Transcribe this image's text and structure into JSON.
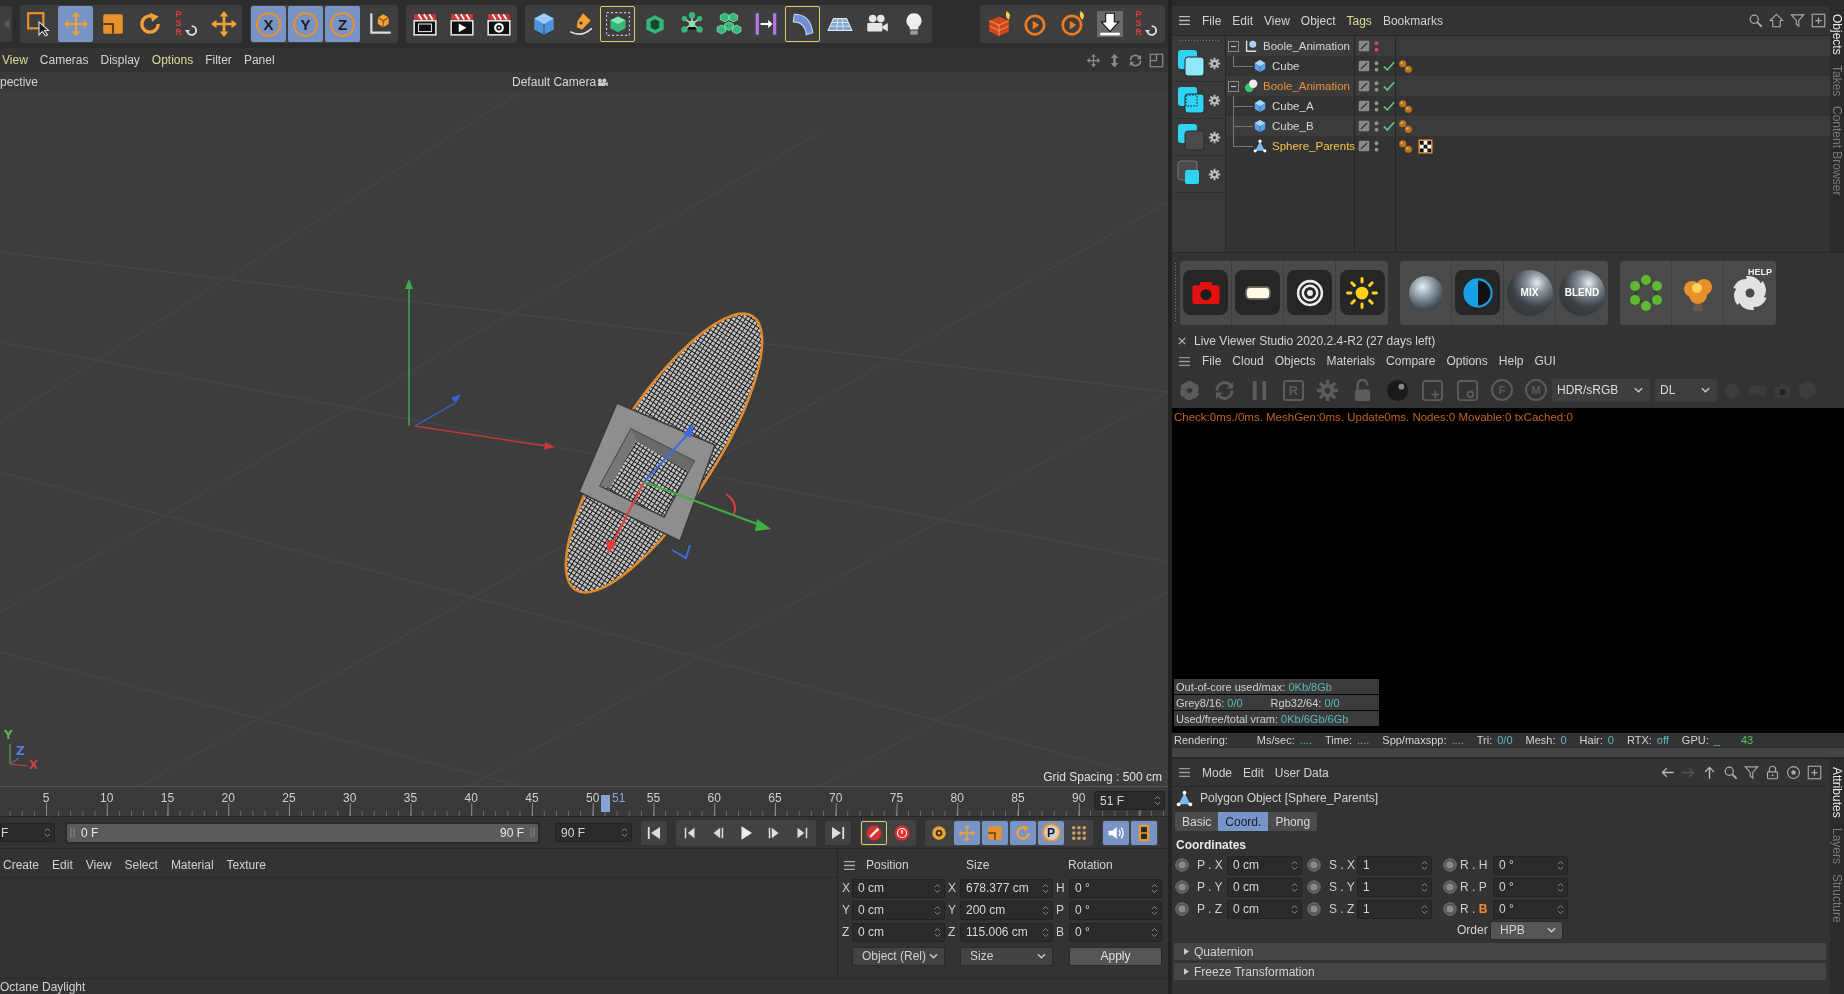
{
  "toolbar": {
    "groups": [
      [
        {
          "kind": "back",
          "selected": false,
          "framed": false
        }
      ],
      [
        {
          "kind": "select",
          "selected": false,
          "framed": false
        },
        {
          "kind": "move",
          "selected": true,
          "framed": false
        },
        {
          "kind": "scale",
          "selected": false,
          "framed": false
        },
        {
          "kind": "rotate",
          "selected": false,
          "framed": false
        },
        {
          "kind": "psr",
          "label": "PSR",
          "selected": false,
          "framed": false
        },
        {
          "kind": "move-plus",
          "selected": false,
          "framed": false
        }
      ],
      [
        {
          "kind": "axis",
          "label": "X",
          "selected": true,
          "framed": false
        },
        {
          "kind": "axis",
          "label": "Y",
          "selected": true,
          "framed": false
        },
        {
          "kind": "axis",
          "label": "Z",
          "selected": true,
          "framed": false
        },
        {
          "kind": "coord-system",
          "selected": false,
          "framed": false
        }
      ],
      [
        {
          "kind": "render-view",
          "selected": false,
          "framed": false
        },
        {
          "kind": "render-picture",
          "selected": false,
          "framed": false
        },
        {
          "kind": "render-settings",
          "selected": false,
          "framed": false
        }
      ],
      [
        {
          "kind": "cube",
          "selected": false,
          "framed": false
        },
        {
          "kind": "pen",
          "selected": false,
          "framed": false
        },
        {
          "kind": "subdivision",
          "selected": false,
          "framed": true
        },
        {
          "kind": "extrude",
          "selected": false,
          "framed": false
        },
        {
          "kind": "cloner",
          "selected": false,
          "framed": false
        },
        {
          "kind": "array",
          "selected": false,
          "framed": false
        },
        {
          "kind": "spline-bar",
          "selected": false,
          "framed": false
        },
        {
          "kind": "deformer",
          "selected": false,
          "framed": true
        },
        {
          "kind": "floor",
          "selected": false,
          "framed": false
        },
        {
          "kind": "camera",
          "selected": false,
          "framed": false
        },
        {
          "kind": "light",
          "selected": false,
          "framed": false
        }
      ],
      [
        {
          "kind": "octane-cube",
          "selected": false,
          "framed": false
        },
        {
          "kind": "octane-render",
          "selected": false,
          "framed": false
        },
        {
          "kind": "octane-render-fire",
          "selected": false,
          "framed": false
        },
        {
          "kind": "octane-download",
          "selected": false,
          "framed": false
        },
        {
          "kind": "psr",
          "label": "PSR",
          "selected": false,
          "framed": false
        }
      ]
    ]
  },
  "viewport": {
    "menu": [
      {
        "label": "View",
        "highlighted": true
      },
      {
        "label": "Cameras",
        "highlighted": false
      },
      {
        "label": "Display",
        "highlighted": false
      },
      {
        "label": "Options",
        "highlighted": true
      },
      {
        "label": "Filter",
        "highlighted": false
      },
      {
        "label": "Panel",
        "highlighted": false
      }
    ],
    "view_name": "pective",
    "camera": "Default Camera",
    "axis_indicator": [
      {
        "label": "Y",
        "color": "#58b858"
      },
      {
        "label": "Z",
        "color": "#4f7fe0"
      },
      {
        "label": "X",
        "color": "#d04040"
      }
    ],
    "grid_spacing": "Grid Spacing : 500 cm"
  },
  "timeline": {
    "ticks": [
      "5",
      "10",
      "15",
      "20",
      "25",
      "30",
      "35",
      "40",
      "45",
      "50",
      "55",
      "60",
      "65",
      "70",
      "75",
      "80",
      "85",
      "90"
    ],
    "playhead": {
      "level": 0.5667
    },
    "current_frame": "51",
    "current_field": "51 F",
    "start_field": "F",
    "range": {
      "level": 1
    },
    "range_start": "0 F",
    "range_end": "90 F",
    "end_field": "90 F"
  },
  "transport": [
    [
      {
        "kind": "go-start",
        "selected": false,
        "framed": false
      }
    ],
    [
      {
        "kind": "prev-key",
        "selected": false,
        "framed": false
      },
      {
        "kind": "prev-frame",
        "selected": false,
        "framed": false
      },
      {
        "kind": "play",
        "selected": false,
        "framed": false
      },
      {
        "kind": "next-frame",
        "selected": false,
        "framed": false
      },
      {
        "kind": "next-key",
        "selected": false,
        "framed": false
      }
    ],
    [
      {
        "kind": "go-end",
        "selected": false,
        "framed": false
      }
    ],
    [
      {
        "kind": "record",
        "selected": false,
        "framed": true
      },
      {
        "kind": "autokey",
        "selected": false,
        "framed": false
      }
    ],
    [
      {
        "kind": "key-selection",
        "selected": false,
        "framed": false
      },
      {
        "kind": "key-move",
        "selected": true,
        "framed": false
      },
      {
        "kind": "key-scale",
        "selected": true,
        "framed": false
      },
      {
        "kind": "key-rotate",
        "selected": true,
        "framed": false
      },
      {
        "kind": "key-param",
        "label": "P",
        "selected": true,
        "framed": false
      },
      {
        "kind": "key-pla",
        "selected": false,
        "framed": false
      }
    ],
    [
      {
        "kind": "sound",
        "selected": true,
        "framed": false
      },
      {
        "kind": "film",
        "selected": true,
        "framed": false
      }
    ]
  ],
  "material_manager": {
    "menu": [
      "Create",
      "Edit",
      "View",
      "Select",
      "Material",
      "Texture"
    ]
  },
  "coordinates": {
    "headers": [
      "Position",
      "Size",
      "Rotation"
    ],
    "rows": [
      [
        {
          "axis": "X",
          "value": "0 cm"
        },
        {
          "axis": "X",
          "value": "678.377 cm"
        },
        {
          "axis": "H",
          "value": "0 °"
        }
      ],
      [
        {
          "axis": "Y",
          "value": "0 cm"
        },
        {
          "axis": "Y",
          "value": "200 cm"
        },
        {
          "axis": "P",
          "value": "0 °"
        }
      ],
      [
        {
          "axis": "Z",
          "value": "0 cm"
        },
        {
          "axis": "Z",
          "value": "115.006 cm"
        },
        {
          "axis": "B",
          "value": "0 °"
        }
      ]
    ],
    "mode": "Object (Rel)",
    "size_mode": "Size",
    "apply": "Apply"
  },
  "status_bar": "Octane Daylight",
  "object_manager": {
    "menu": [
      {
        "label": "File",
        "highlighted": false
      },
      {
        "label": "Edit",
        "highlighted": false
      },
      {
        "label": "View",
        "highlighted": false
      },
      {
        "label": "Object",
        "highlighted": false
      },
      {
        "label": "Tags",
        "highlighted": true
      },
      {
        "label": "Bookmarks",
        "highlighted": false
      }
    ],
    "tree": [
      {
        "name": "Boole_Animation",
        "kind": "null",
        "selected": false,
        "active": false,
        "visible": false,
        "enable_switch": false,
        "expanded": true,
        "children": [
          {
            "name": "Cube",
            "kind": "cube",
            "selected": false,
            "active": false,
            "visible": true,
            "enable_switch": true,
            "tags": [
              {
                "kind": "octane",
                "selected": false
              }
            ]
          }
        ]
      },
      {
        "name": "Boole_Animation",
        "kind": "boole",
        "selected": true,
        "active": false,
        "visible": true,
        "enable_switch": true,
        "expanded": true,
        "children": [
          {
            "name": "Cube_A",
            "kind": "cube",
            "selected": false,
            "active": false,
            "visible": true,
            "enable_switch": true,
            "tags": [
              {
                "kind": "octane",
                "selected": false
              }
            ]
          },
          {
            "name": "Cube_B",
            "kind": "cube",
            "selected": false,
            "active": false,
            "visible": true,
            "enable_switch": true,
            "tags": [
              {
                "kind": "octane",
                "selected": false
              }
            ]
          },
          {
            "name": "Sphere_Parents",
            "kind": "polygon",
            "selected": true,
            "active": true,
            "visible": true,
            "enable_switch": false,
            "tags": [
              {
                "kind": "octane",
                "selected": false
              },
              {
                "kind": "material",
                "selected": true
              }
            ]
          }
        ]
      }
    ],
    "side_tabs": [
      {
        "label": "Objects",
        "selected": true
      },
      {
        "label": "Takes",
        "selected": false
      },
      {
        "label": "Content Browser",
        "selected": false
      }
    ]
  },
  "octane_toolbar": [
    [
      {
        "kind": "camera"
      },
      {
        "kind": "area-light"
      },
      {
        "kind": "target-light"
      },
      {
        "kind": "sun"
      }
    ],
    [
      {
        "kind": "glossy"
      },
      {
        "kind": "contrast"
      },
      {
        "kind": "ball",
        "label": "MIX"
      },
      {
        "kind": "ball",
        "label": "BLEND"
      }
    ],
    [
      {
        "kind": "scatter"
      },
      {
        "kind": "explosion"
      },
      {
        "kind": "help",
        "label": "HELP"
      }
    ]
  ],
  "live_viewer": {
    "title": "Live Viewer Studio 2020.2.4-R2 (27 days left)",
    "menu": [
      "File",
      "Cloud",
      "Objects",
      "Materials",
      "Compare",
      "Options",
      "Help",
      "GUI"
    ],
    "tools": [
      {
        "kind": "octane-logo"
      },
      {
        "kind": "restart"
      },
      {
        "kind": "pause"
      },
      {
        "kind": "boxed",
        "label": "R"
      },
      {
        "kind": "settings"
      },
      {
        "kind": "lock"
      },
      {
        "kind": "material-ball"
      },
      {
        "kind": "add-box"
      },
      {
        "kind": "circle-box"
      },
      {
        "kind": "pin",
        "label": "F"
      },
      {
        "kind": "pin",
        "label": "M"
      },
      {
        "kind": "dropdown",
        "value": "HDR/sRGB"
      },
      {
        "kind": "dropdown",
        "value": "DL"
      },
      {
        "kind": "hexagon"
      },
      {
        "kind": "rectangle"
      },
      {
        "kind": "snapshot"
      },
      {
        "kind": "disc"
      }
    ],
    "log": "Check:0ms./0ms. MeshGen:0ms. Update0ms. Nodes:0 Movable:0 txCached:0",
    "info": [
      [
        {
          "label": "Out-of-core used/max:",
          "value": "0Kb/8Gb"
        }
      ],
      [
        {
          "label": "Grey8/16:",
          "value": "0/0"
        },
        {
          "label": "Rgb32/64:",
          "value": "0/0"
        }
      ],
      [
        {
          "label": "Used/free/total vram:",
          "value": "0Kb/6Gb/6Gb"
        }
      ]
    ],
    "stats": [
      {
        "label": "Rendering:"
      },
      {
        "label": "Ms/sec:",
        "value": "...."
      },
      {
        "label": "Time:",
        "value": "...."
      },
      {
        "label": "Spp/maxspp:",
        "value": "...."
      },
      {
        "label": "Tri:",
        "value": "0/0"
      },
      {
        "label": "Mesh:",
        "value": "0"
      },
      {
        "label": "Hair:",
        "value": "0"
      },
      {
        "label": "RTX:",
        "value": "off"
      },
      {
        "label": "GPU:",
        "value": "_"
      }
    ],
    "gpu_reading": "43"
  },
  "attributes": {
    "menu": [
      "Mode",
      "Edit",
      "User Data"
    ],
    "title": "Polygon Object [Sphere_Parents]",
    "tabs": [
      {
        "label": "Basic",
        "selected": false
      },
      {
        "label": "Coord.",
        "selected": true
      },
      {
        "label": "Phong",
        "selected": false
      }
    ],
    "section": "Coordinates",
    "rows": [
      [
        {
          "prefix": "P .",
          "axis": "X",
          "value": "0 cm",
          "axis_highlighted": false
        },
        {
          "prefix": "S .",
          "axis": "X",
          "value": "1",
          "axis_highlighted": false
        },
        {
          "prefix": "R .",
          "axis": "H",
          "value": "0 °",
          "axis_highlighted": false
        }
      ],
      [
        {
          "prefix": "P .",
          "axis": "Y",
          "value": "0 cm",
          "axis_highlighted": false
        },
        {
          "prefix": "S .",
          "axis": "Y",
          "value": "1",
          "axis_highlighted": false
        },
        {
          "prefix": "R .",
          "axis": "P",
          "value": "0 °",
          "axis_highlighted": false
        }
      ],
      [
        {
          "prefix": "P .",
          "axis": "Z",
          "value": "0 cm",
          "axis_highlighted": false
        },
        {
          "prefix": "S .",
          "axis": "Z",
          "value": "1",
          "axis_highlighted": false
        },
        {
          "prefix": "R .",
          "axis": "B",
          "value": "0 °",
          "axis_highlighted": true
        }
      ]
    ],
    "order": {
      "label": "Order",
      "value": "HPB"
    },
    "groups": [
      {
        "label": "Quaternion",
        "expanded": false
      },
      {
        "label": "Freeze Transformation",
        "expanded": false
      }
    ],
    "side_tabs": [
      {
        "label": "Attributes",
        "selected": true
      },
      {
        "label": "Layers",
        "selected": false
      },
      {
        "label": "Structure",
        "selected": false
      }
    ]
  }
}
